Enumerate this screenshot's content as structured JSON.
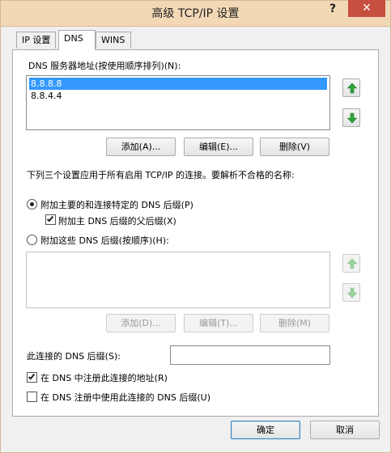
{
  "window": {
    "title": "高级 TCP/IP 设置",
    "help": "?",
    "close": "✕"
  },
  "tabs": [
    {
      "label": "IP 设置",
      "active": false
    },
    {
      "label": "DNS",
      "active": true
    },
    {
      "label": "WINS",
      "active": false
    }
  ],
  "dns_servers": {
    "label": "DNS 服务器地址(按使用顺序排列)(N):",
    "items": [
      "8.8.8.8",
      "8.8.4.4"
    ],
    "selected_index": 0,
    "add": "添加(A)...",
    "edit": "编辑(E)...",
    "remove": "删除(V)"
  },
  "description": "下列三个设置应用于所有启用 TCP/IP 的连接。要解析不合格的名称:",
  "options": {
    "append_primary": "附加主要的和连接特定的 DNS 后缀(P)",
    "append_parent": "附加主 DNS 后缀的父后缀(X)",
    "append_these": "附加这些 DNS 后缀(按顺序)(H):"
  },
  "suffix_list": {
    "items": [],
    "add": "添加(D)...",
    "edit": "编辑(T)...",
    "remove": "删除(M)"
  },
  "connection_suffix": {
    "label": "此连接的 DNS 后缀(S):",
    "value": ""
  },
  "checks": {
    "register": "在 DNS 中注册此连接的地址(R)",
    "use_suffix": "在 DNS 注册中使用此连接的 DNS 后缀(U)"
  },
  "footer": {
    "ok": "确定",
    "cancel": "取消"
  },
  "icons": {
    "up": "arrow-up-icon",
    "down": "arrow-down-icon",
    "arrow_color": "#2fa33a",
    "arrow_color_disabled": "#9bd49f"
  },
  "colors": {
    "selection": "#3399ff",
    "titlebar": "#f3d8b6",
    "close": "#c74f3f"
  }
}
